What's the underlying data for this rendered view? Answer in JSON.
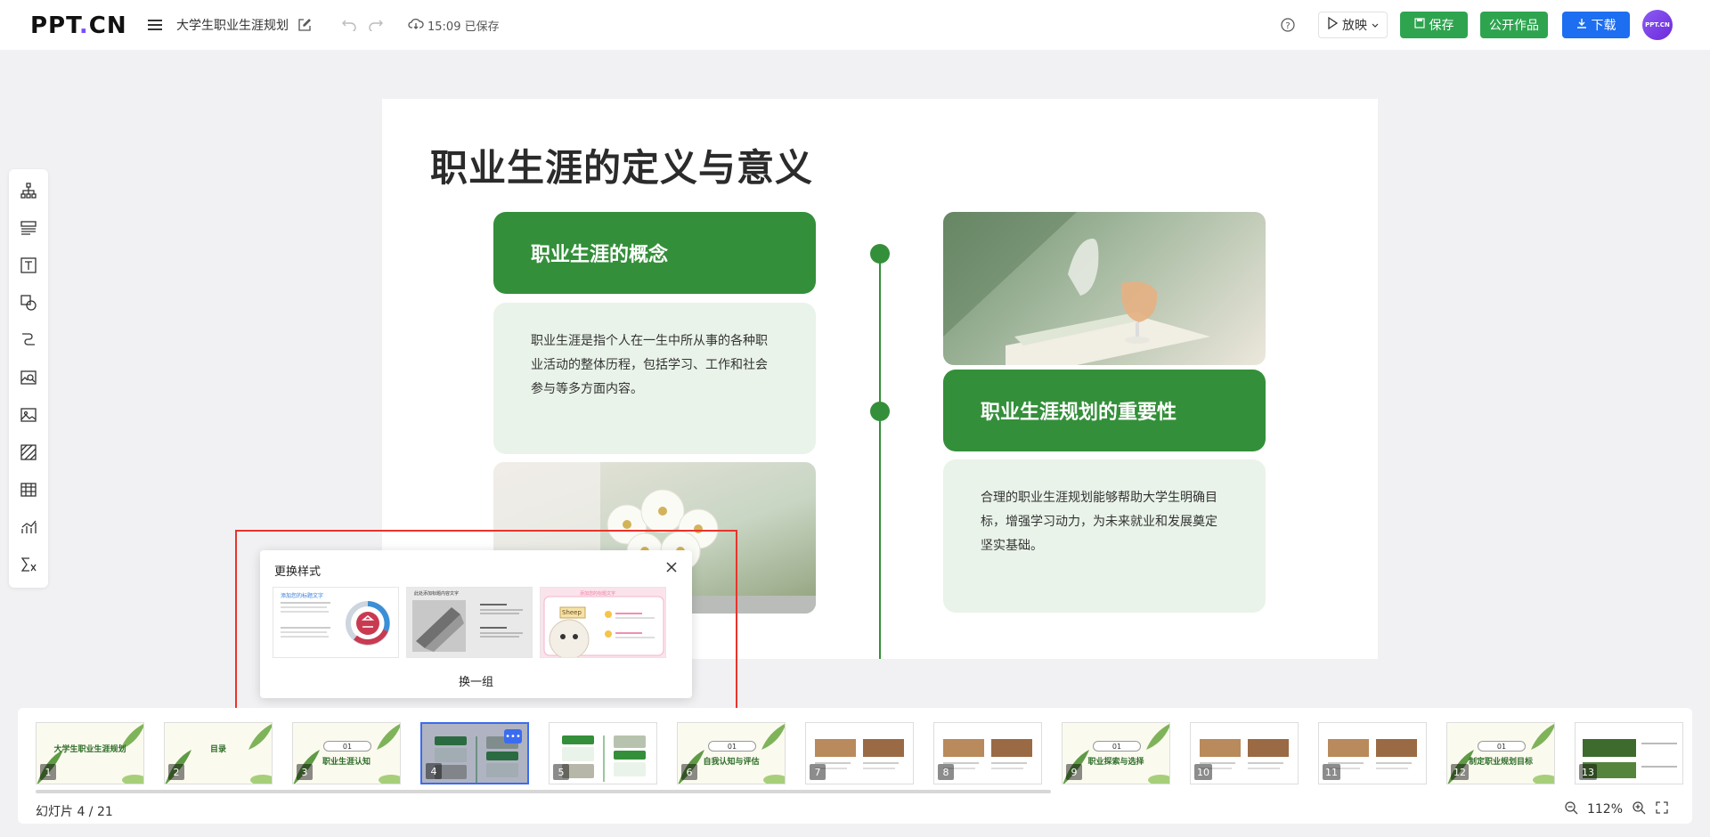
{
  "header": {
    "logo_main": "PPT",
    "logo_dot": ".",
    "logo_end": "CN",
    "doc_title": "大学生职业生涯规划",
    "save_status": "15:09 已保存",
    "play_label": "放映",
    "save_label": "保存",
    "publish_label": "公开作品",
    "download_label": "下载",
    "avatar_text": "PPT.CN"
  },
  "slide": {
    "title": "职业生涯的定义与意义",
    "box1_title": "职业生涯的概念",
    "box1_text": "职业生涯是指个人在一生中所从事的各种职业活动的整体历程，包括学习、工作和社会参与等多方面内容。",
    "box2_title": "职业生涯规划的重要性",
    "box2_text": "合理的职业生涯规划能够帮助大学生明确目标，增强学习动力，为未来就业和发展奠定坚实基础。",
    "accent": "#348f3a"
  },
  "popup": {
    "title": "更换样式",
    "swap_label": "换一组",
    "card1_heading": "添加您的标题文字",
    "card2_heading": "此处添加标题内容文字",
    "card3_heading": "添加您的标题文字",
    "card3_sign": "Sheep"
  },
  "filmstrip": {
    "thumbs": [
      {
        "num": "1",
        "text": "大学生职业生涯规划"
      },
      {
        "num": "2",
        "text": "目录"
      },
      {
        "num": "3",
        "text": "职业生涯认知",
        "badge": "01"
      },
      {
        "num": "4",
        "text": ""
      },
      {
        "num": "5",
        "text": ""
      },
      {
        "num": "6",
        "text": "自我认知与评估",
        "badge": "01"
      },
      {
        "num": "7",
        "text": ""
      },
      {
        "num": "8",
        "text": ""
      },
      {
        "num": "9",
        "text": "职业探索与选择",
        "badge": "01"
      },
      {
        "num": "10",
        "text": ""
      },
      {
        "num": "11",
        "text": ""
      },
      {
        "num": "12",
        "text": "制定职业规划目标",
        "badge": "01"
      },
      {
        "num": "13",
        "text": ""
      }
    ],
    "counter": "幻灯片 4 / 21",
    "zoom": "112%"
  }
}
